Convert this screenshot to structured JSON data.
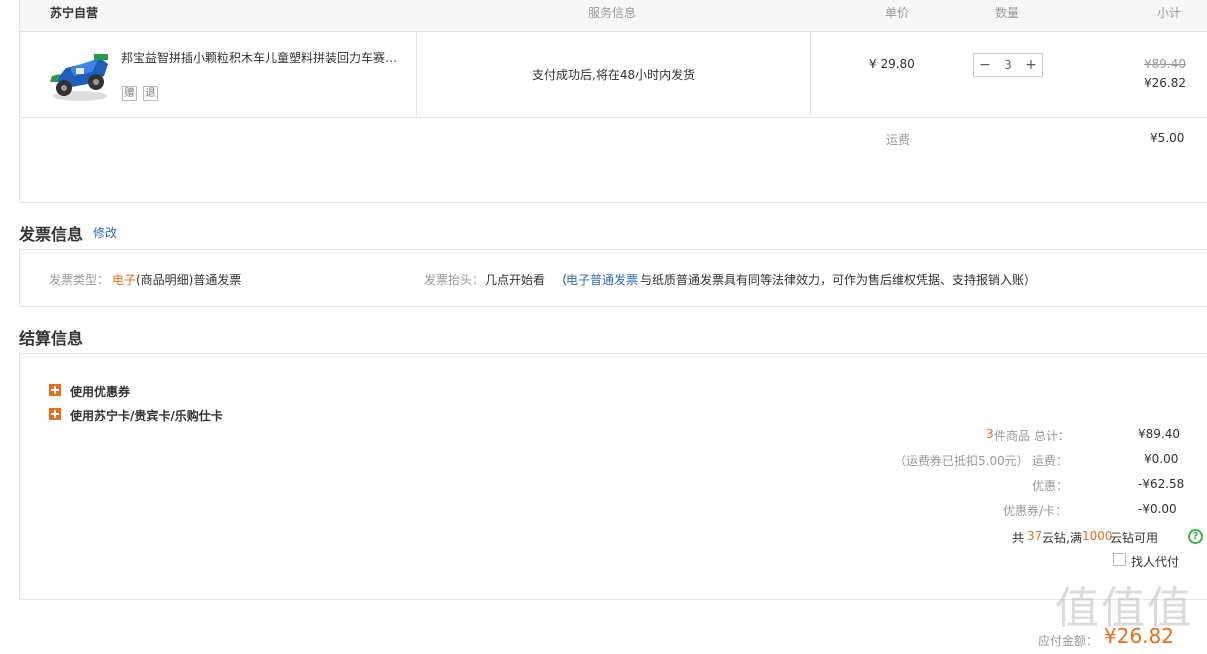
{
  "order": {
    "store_name": "苏宁自营",
    "columns": {
      "service": "服务信息",
      "unit_price": "单价",
      "quantity": "数量",
      "subtotal": "小计"
    },
    "item": {
      "title": "邦宝益智拼插小颗粒积木车儿童塑料拼装回力车赛…",
      "tags": [
        "赠",
        "退"
      ],
      "service": "支付成功后,将在48小时内发货",
      "unit_price": "¥ 29.80",
      "quantity": "3",
      "subtotal_original": "¥89.40",
      "subtotal": "¥26.82"
    },
    "shipping_label": "运费",
    "shipping_value": "¥5.00"
  },
  "invoice": {
    "title": "发票信息",
    "edit_link": "修改",
    "type_label": "发票类型：",
    "type_highlight": "电子",
    "type_value": "(商品明细)普通发票",
    "header_label": "发票抬头：",
    "header_value": "几点开始看",
    "note_open": "（",
    "note_link": "电子普通发票",
    "note_text": "与纸质普通发票具有同等法律效力，可作为售后维权凭据、支持报销入账）"
  },
  "settlement": {
    "title": "结算信息",
    "use_coupon": "使用优惠券",
    "use_card": "使用苏宁卡/贵宾卡/乐购仕卡",
    "items_count": "3",
    "items_label": "件商品 总计：",
    "items_total": "¥89.40",
    "freight_note": "（运费券已抵扣5.00元）",
    "freight_label": "运费：",
    "freight_value": "¥0.00",
    "discount_label": "优惠：",
    "discount_value": "-¥62.58",
    "coupon_label": "优惠券/卡：",
    "coupon_value": "-¥0.00",
    "cloud_prefix": "共",
    "cloud_count": "37",
    "cloud_mid": "云钻,满",
    "cloud_threshold": "1000",
    "cloud_suffix": "云钻可用",
    "proxy_pay": "找人代付"
  },
  "total": {
    "label": "应付金额：",
    "value": "¥26.82"
  },
  "watermark": "值值值"
}
